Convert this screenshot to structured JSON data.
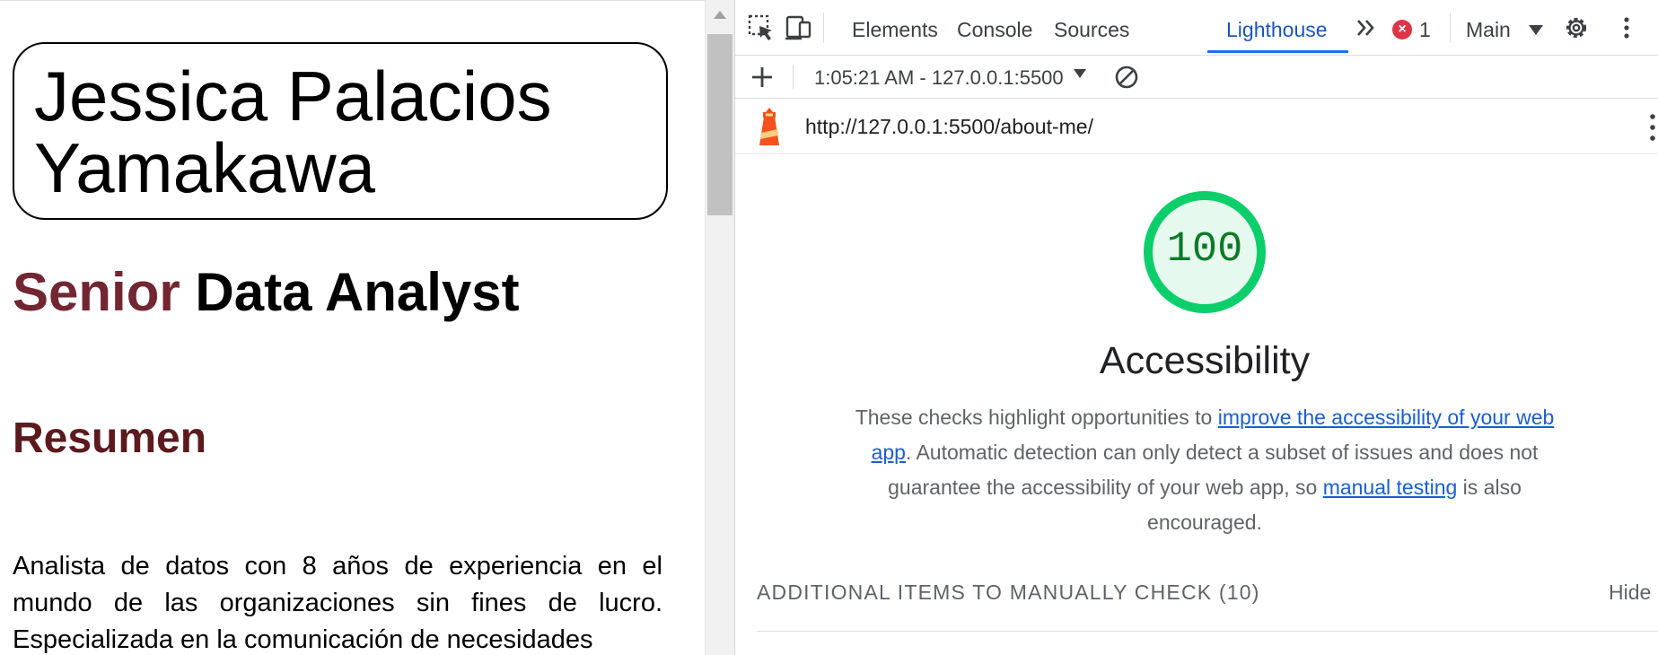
{
  "page": {
    "name": "Jessica Palacios\nYamakawa",
    "role_accent": "Senior",
    "role_rest": "Data Analyst",
    "section_heading": "Resumen",
    "summary": "Analista de datos con 8 años de experiencia en el mundo de las organizaciones sin fines de lucro. Especializada en la comunicación de necesidades"
  },
  "devtools": {
    "tabs": [
      "Elements",
      "Console",
      "Sources",
      "Lighthouse"
    ],
    "active_tab": "Lighthouse",
    "error_count": "1",
    "error_icon": "×",
    "context": "Main",
    "report_label": "1:05:21 AM - 127.0.0.1:5500",
    "url": "http://127.0.0.1:5500/about-me/",
    "score": "100",
    "score_fraction": 1.0,
    "category": "Accessibility",
    "description": {
      "pre": "These checks highlight opportunities to ",
      "link1": "improve the accessibility of your web app",
      "mid": ". Automatic detection can only detect a subset of issues and does not guarantee the accessibility of your web app, so ",
      "link2": "manual testing",
      "post": " is also encouraged."
    },
    "manual_section": "ADDITIONAL ITEMS TO MANUALLY CHECK",
    "manual_count": "(10)",
    "hide_label": "Hide"
  },
  "colors": {
    "score_green": "#0cce6b",
    "score_text": "#0b7a27",
    "accent_maroon": "#722632",
    "link_blue": "#1a5fd0"
  },
  "icons": [
    "inspect-element-icon",
    "device-toolbar-icon",
    "more-tabs-icon",
    "error-icon",
    "settings-gear-icon",
    "kebab-menu-icon",
    "plus-icon",
    "clear-icon",
    "lighthouse-logo-icon"
  ]
}
